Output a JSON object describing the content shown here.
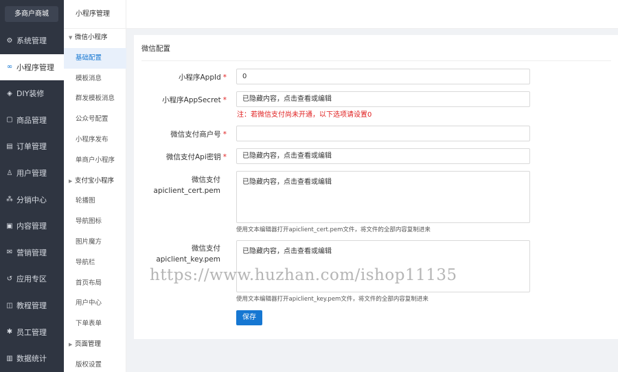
{
  "sidebar": {
    "brand": "多商户商城",
    "items": [
      {
        "label": "系统管理",
        "icon": "gear-icon",
        "glyph": "⚙"
      },
      {
        "label": "小程序管理",
        "icon": "link-icon",
        "glyph": "∞"
      },
      {
        "label": "DIY装修",
        "icon": "diy-icon",
        "glyph": "◈"
      },
      {
        "label": "商品管理",
        "icon": "box-icon",
        "glyph": "▢"
      },
      {
        "label": "订单管理",
        "icon": "order-icon",
        "glyph": "▤"
      },
      {
        "label": "用户管理",
        "icon": "user-icon",
        "glyph": "♙"
      },
      {
        "label": "分销中心",
        "icon": "network-icon",
        "glyph": "⁂"
      },
      {
        "label": "内容管理",
        "icon": "content-icon",
        "glyph": "▣"
      },
      {
        "label": "营销管理",
        "icon": "mail-icon",
        "glyph": "✉"
      },
      {
        "label": "应用专区",
        "icon": "app-icon",
        "glyph": "↺"
      },
      {
        "label": "教程管理",
        "icon": "book-icon",
        "glyph": "◫"
      },
      {
        "label": "员工管理",
        "icon": "gear-bold-icon",
        "glyph": "✱"
      },
      {
        "label": "数据统计",
        "icon": "chart-icon",
        "glyph": "▥"
      }
    ]
  },
  "subnav": {
    "title": "小程序管理",
    "items": [
      {
        "label": "微信小程序",
        "group": true,
        "expanded": true
      },
      {
        "label": "基础配置",
        "active": true
      },
      {
        "label": "模板消息"
      },
      {
        "label": "群发模板消息"
      },
      {
        "label": "公众号配置"
      },
      {
        "label": "小程序发布"
      },
      {
        "label": "单商户小程序"
      },
      {
        "label": "支付宝小程序",
        "group": true,
        "expanded": false
      },
      {
        "label": "轮播图"
      },
      {
        "label": "导航图标"
      },
      {
        "label": "图片魔方"
      },
      {
        "label": "导航栏"
      },
      {
        "label": "首页布局"
      },
      {
        "label": "用户中心"
      },
      {
        "label": "下单表单"
      },
      {
        "label": "页面管理",
        "group": true,
        "expanded": false
      },
      {
        "label": "版权设置"
      }
    ]
  },
  "form": {
    "title": "微信配置",
    "appid_label": "小程序AppId",
    "appid_value": "0",
    "secret_label": "小程序AppSecret",
    "secret_value": "已隐藏内容，点击查看或编辑",
    "note": "注：若微信支付尚未开通，以下选项请设置0",
    "mchid_label": "微信支付商户号",
    "mchid_value": "",
    "apikey_label": "微信支付Api密钥",
    "apikey_value": "已隐藏内容，点击查看或编辑",
    "cert_label_1": "微信支付",
    "cert_label_2": "apiclient_cert.pem",
    "cert_value": "已隐藏内容，点击查看或编辑",
    "cert_hint": "使用文本编辑器打开apiclient_cert.pem文件，将文件的全部内容复制进来",
    "key_label_1": "微信支付",
    "key_label_2": "apiclient_key.pem",
    "key_value": "已隐藏内容，点击查看或编辑",
    "key_hint": "使用文本编辑器打开apiclient_key.pem文件，将文件的全部内容复制进来",
    "required_mark": "*",
    "save_label": "保存"
  },
  "watermark": "https://www.huzhan.com/ishop11135",
  "colors": {
    "accent": "#1677d2",
    "sidebar": "#2f3541",
    "required": "#e02020"
  }
}
